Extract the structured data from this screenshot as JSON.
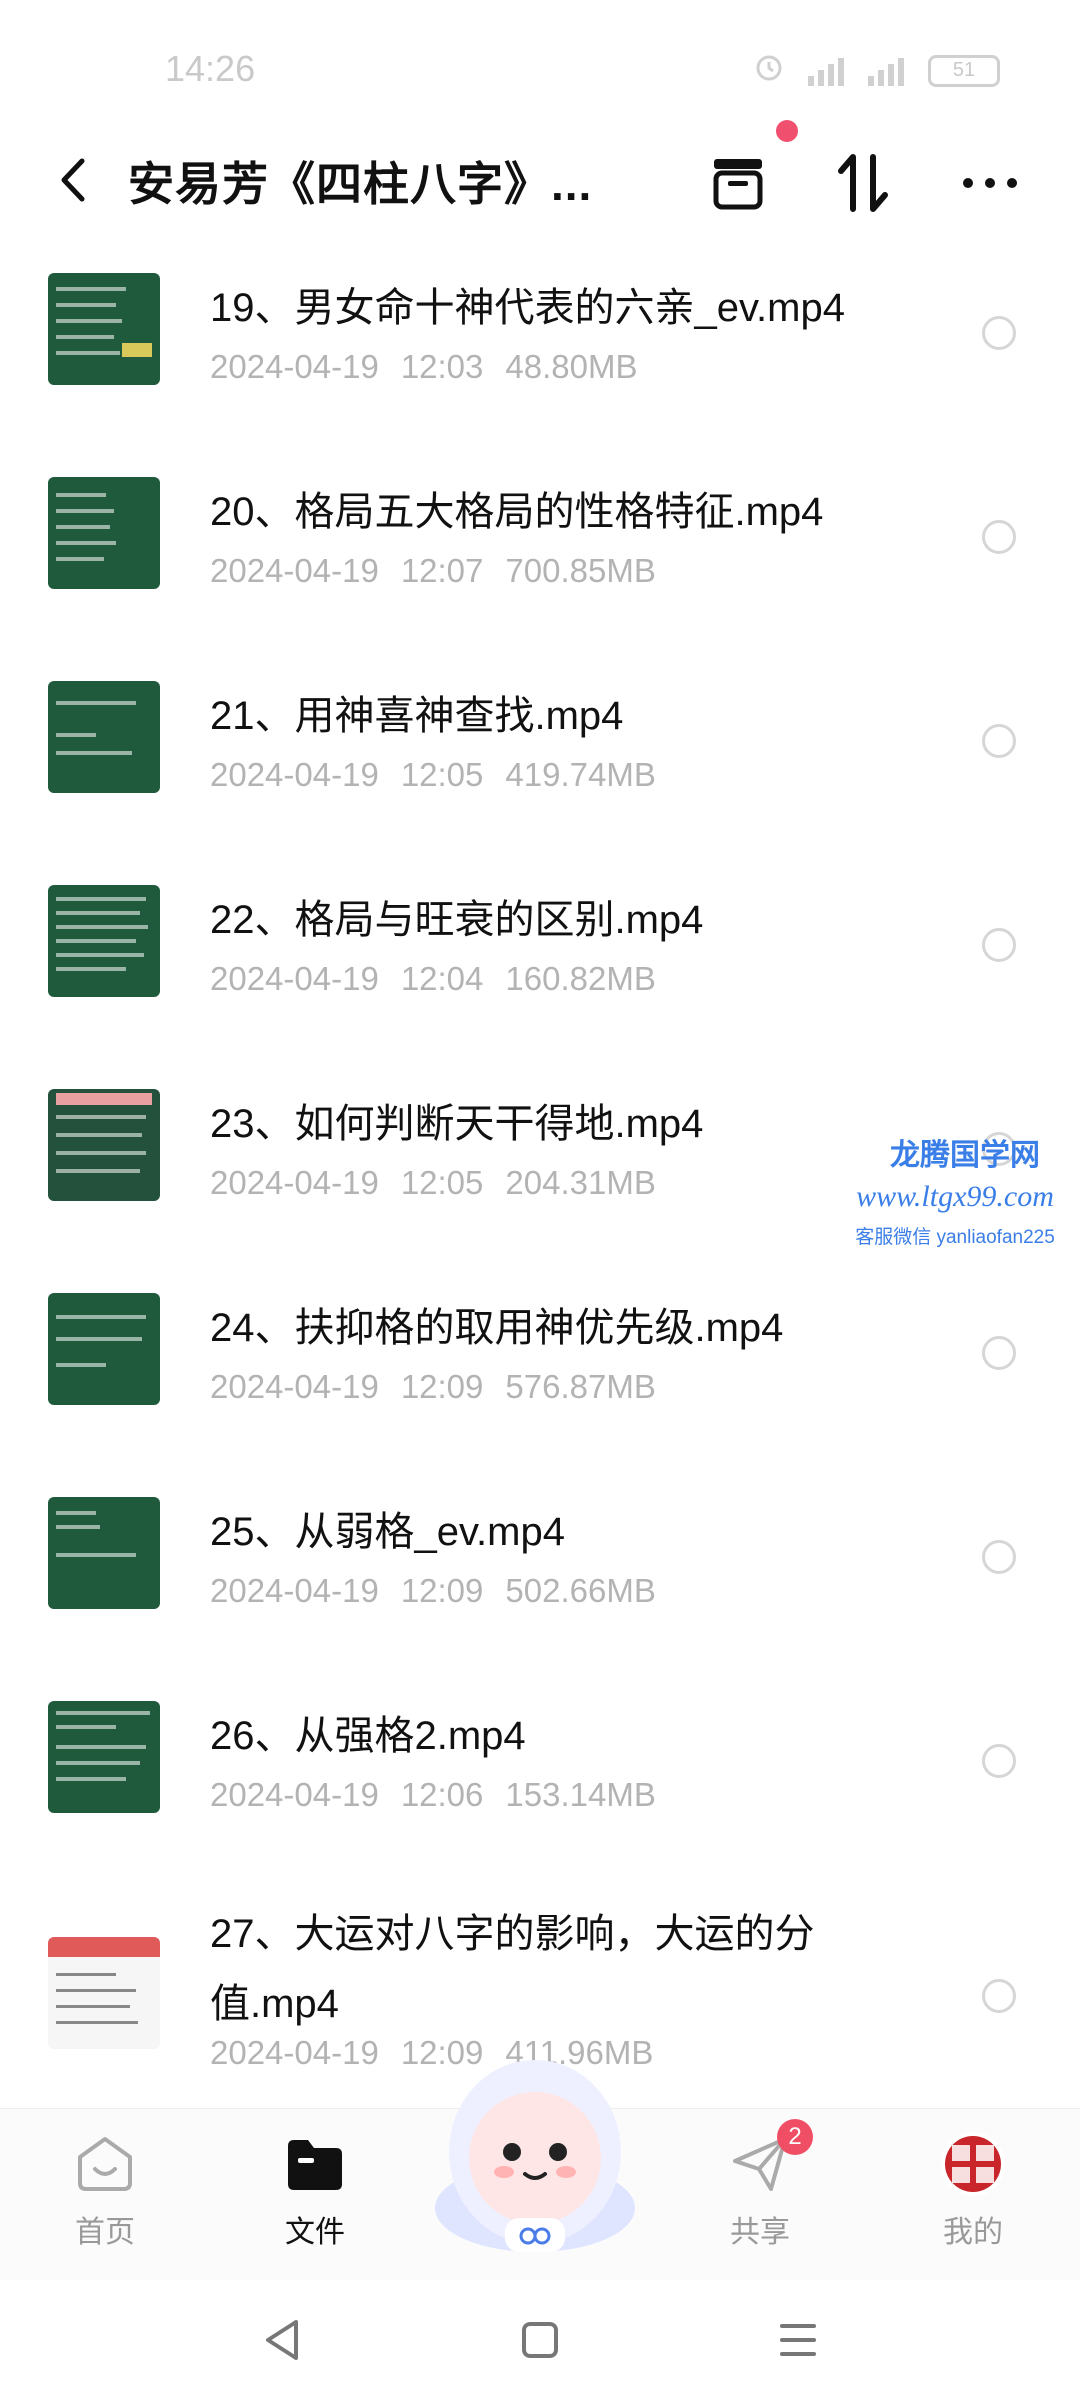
{
  "status_bar": {
    "time": "14:26",
    "battery": "51"
  },
  "header": {
    "title": "安易芳《四柱八字》..."
  },
  "files": [
    {
      "name": "19、男女命十神代表的六亲_ev.mp4",
      "date": "2024-04-19",
      "time": "12:03",
      "size": "48.80MB"
    },
    {
      "name": "20、格局五大格局的性格特征.mp4",
      "date": "2024-04-19",
      "time": "12:07",
      "size": "700.85MB"
    },
    {
      "name": "21、用神喜神查找.mp4",
      "date": "2024-04-19",
      "time": "12:05",
      "size": "419.74MB"
    },
    {
      "name": "22、格局与旺衰的区别.mp4",
      "date": "2024-04-19",
      "time": "12:04",
      "size": "160.82MB"
    },
    {
      "name": "23、如何判断天干得地.mp4",
      "date": "2024-04-19",
      "time": "12:05",
      "size": "204.31MB"
    },
    {
      "name": "24、扶抑格的取用神优先级.mp4",
      "date": "2024-04-19",
      "time": "12:09",
      "size": "576.87MB"
    },
    {
      "name": "25、从弱格_ev.mp4",
      "date": "2024-04-19",
      "time": "12:09",
      "size": "502.66MB"
    },
    {
      "name": "26、从强格2.mp4",
      "date": "2024-04-19",
      "time": "12:06",
      "size": "153.14MB"
    },
    {
      "name": "27、大运对八字的影响，大运的分值.mp4",
      "date": "2024-04-19",
      "time": "12:09",
      "size": "411.96MB"
    }
  ],
  "watermark": {
    "line1": "龙腾国学网",
    "line2": "www.ltgx99.com",
    "line3": "客服微信 yanliaofan225"
  },
  "bottom_nav": {
    "home": "首页",
    "files": "文件",
    "share": "共享",
    "share_badge": "2",
    "mine": "我的"
  },
  "colors": {
    "accent_red": "#f04e65",
    "thumb_green": "#1f5a3d",
    "watermark_blue": "#3a7ee8"
  }
}
